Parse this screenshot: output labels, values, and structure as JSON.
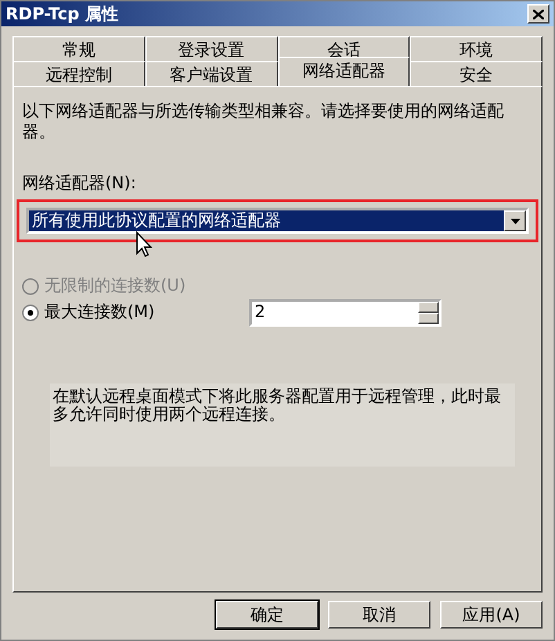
{
  "window": {
    "title": "RDP-Tcp 属性"
  },
  "tab_rows": [
    {
      "tabs": [
        {
          "label": "常规",
          "selected": false
        },
        {
          "label": "登录设置",
          "selected": false
        },
        {
          "label": "会话",
          "selected": false
        },
        {
          "label": "环境",
          "selected": false
        }
      ]
    },
    {
      "tabs": [
        {
          "label": "远程控制",
          "selected": false
        },
        {
          "label": "客户端设置",
          "selected": false
        },
        {
          "label": "网络适配器",
          "selected": true
        },
        {
          "label": "安全",
          "selected": false
        }
      ]
    }
  ],
  "description": "以下网络适配器与所选传输类型相兼容。请选择要使用的网络适配器。",
  "adapter": {
    "label": "网络适配器(N):",
    "value": "所有使用此协议配置的网络适配器",
    "highlighted": true
  },
  "connections": [
    {
      "label": "无限制的连接数(U)",
      "selected": false,
      "disabled": true
    },
    {
      "label": "最大连接数(M)",
      "selected": true,
      "disabled": false
    }
  ],
  "max_connections": {
    "value": "2"
  },
  "note": "在默认远程桌面模式下将此服务器配置用于远程管理，此时最多允许同时使用两个远程连接。",
  "buttons": [
    {
      "label": "确定",
      "kind": "default"
    },
    {
      "label": "取消",
      "kind": "normal"
    },
    {
      "label": "应用(A)",
      "kind": "normal"
    }
  ]
}
